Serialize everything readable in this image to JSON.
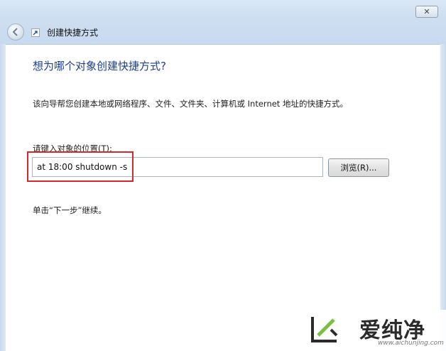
{
  "window": {
    "title": "创建快捷方式",
    "close_glyph": "✕"
  },
  "wizard": {
    "heading": "想为哪个对象创建快捷方式?",
    "description": "该向导帮您创建本地或网络程序、文件、文件夹、计算机或 Internet 地址的快捷方式。",
    "input_label": "请键入对象的位置(T):",
    "input_value": "at 18:00 shutdown -s",
    "browse_label": "浏览(R)...",
    "hint": "单击“下一步”继续。"
  },
  "watermark": {
    "text": "爱纯净",
    "url": "www.aichunjing.com"
  },
  "colors": {
    "heading": "#1e3f8a",
    "highlight": "#d2282e"
  }
}
